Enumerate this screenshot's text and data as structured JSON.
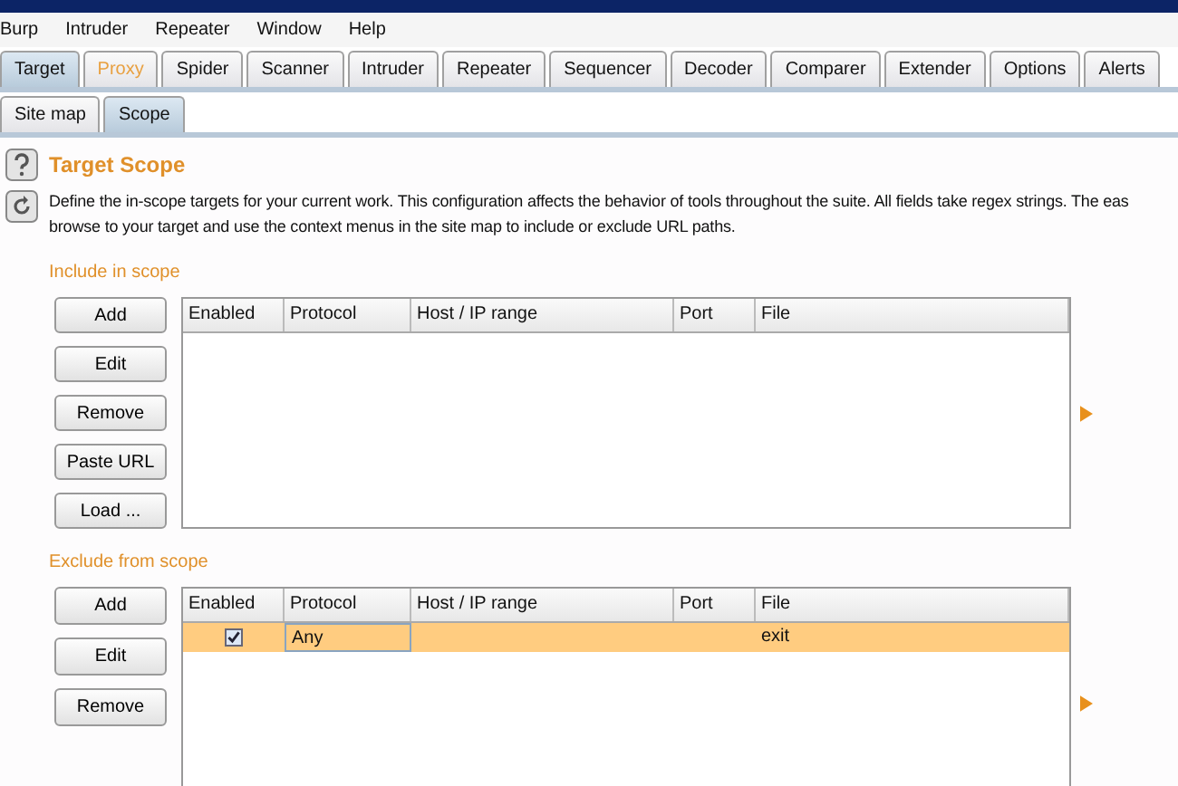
{
  "menu": [
    "Burp",
    "Intruder",
    "Repeater",
    "Window",
    "Help"
  ],
  "tabs": [
    {
      "label": "Target",
      "selected": true,
      "highlighted": false
    },
    {
      "label": "Proxy",
      "selected": false,
      "highlighted": true
    },
    {
      "label": "Spider",
      "selected": false,
      "highlighted": false
    },
    {
      "label": "Scanner",
      "selected": false,
      "highlighted": false
    },
    {
      "label": "Intruder",
      "selected": false,
      "highlighted": false
    },
    {
      "label": "Repeater",
      "selected": false,
      "highlighted": false
    },
    {
      "label": "Sequencer",
      "selected": false,
      "highlighted": false
    },
    {
      "label": "Decoder",
      "selected": false,
      "highlighted": false
    },
    {
      "label": "Comparer",
      "selected": false,
      "highlighted": false
    },
    {
      "label": "Extender",
      "selected": false,
      "highlighted": false
    },
    {
      "label": "Options",
      "selected": false,
      "highlighted": false
    },
    {
      "label": "Alerts",
      "selected": false,
      "highlighted": false
    }
  ],
  "subtabs": [
    {
      "label": "Site map",
      "selected": false
    },
    {
      "label": "Scope",
      "selected": true
    }
  ],
  "title": "Target Scope",
  "description": [
    "Define the in-scope targets for your current work. This configuration affects the behavior of tools throughout the suite. All fields take regex strings. The eas",
    "browse to your target and use the context menus in the site map to include or exclude URL paths."
  ],
  "include": {
    "label": "Include in scope",
    "buttons": [
      "Add",
      "Edit",
      "Remove",
      "Paste URL",
      "Load ..."
    ],
    "columns": [
      "Enabled",
      "Protocol",
      "Host / IP range",
      "Port",
      "File"
    ]
  },
  "exclude": {
    "label": "Exclude from scope",
    "buttons": [
      "Add",
      "Edit",
      "Remove"
    ],
    "columns": [
      "Enabled",
      "Protocol",
      "Host / IP range",
      "Port",
      "File"
    ],
    "rows": [
      {
        "checked": true,
        "selected": true,
        "protocol": "Any",
        "file": "exit"
      }
    ]
  }
}
